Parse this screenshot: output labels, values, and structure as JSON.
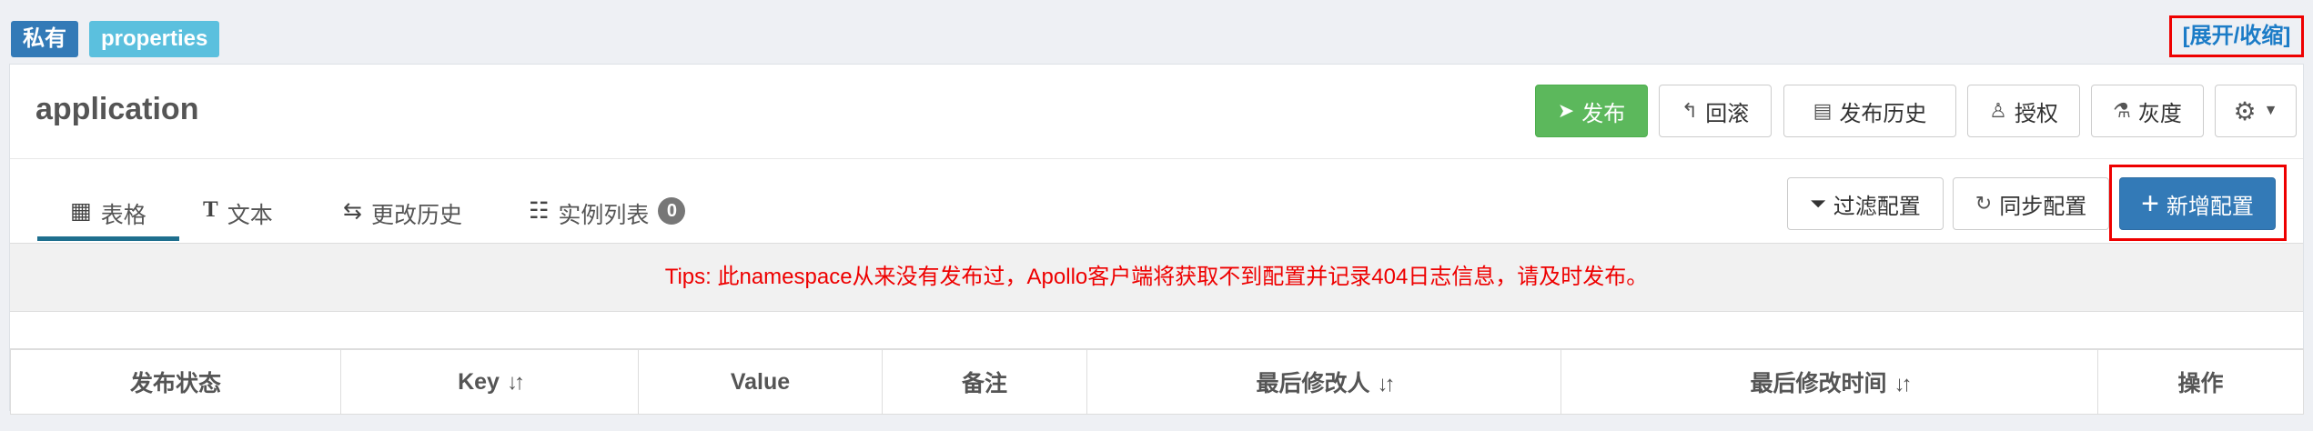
{
  "namespace": {
    "scope_badge": "私有",
    "format_badge": "properties",
    "toggle_label": "[展开/收缩]",
    "title": "application"
  },
  "toolbar": {
    "publish": "发布",
    "rollback": "回滚",
    "publish_history": "发布历史",
    "authorize": "授权",
    "gray": "灰度"
  },
  "tabs": [
    {
      "label": "表格",
      "icon": "table-icon",
      "active": true
    },
    {
      "label": "文本",
      "icon": "text-icon",
      "active": false
    },
    {
      "label": "更改历史",
      "icon": "history-icon",
      "active": false
    },
    {
      "label": "实例列表",
      "icon": "list-icon",
      "active": false,
      "count": "0"
    }
  ],
  "actions": {
    "filter": "过滤配置",
    "sync": "同步配置",
    "add": "新增配置"
  },
  "tips": "Tips: 此namespace从来没有发布过，Apollo客户端将获取不到配置并记录404日志信息，请及时发布。",
  "table": {
    "columns": [
      "发布状态",
      "Key",
      "Value",
      "备注",
      "最后修改人",
      "最后修改时间",
      "操作"
    ]
  },
  "colors": {
    "publish": "#5cb85c",
    "primary": "#337ab7",
    "info": "#5bc0de",
    "tips_text": "#ee0000",
    "highlight": "#ee0000"
  }
}
